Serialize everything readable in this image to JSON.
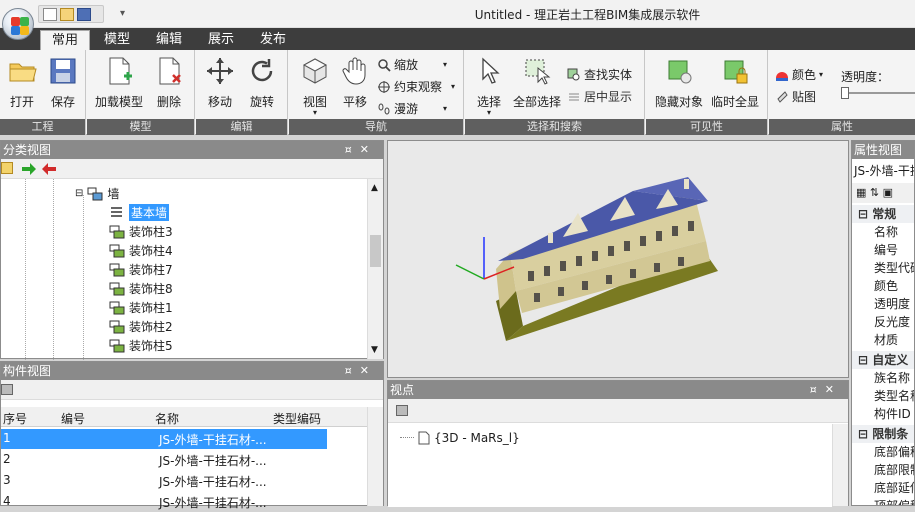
{
  "window": {
    "title": "Untitled - 理正岩土工程BIM集成展示软件"
  },
  "ribbon_tabs": [
    {
      "label": "常用",
      "active": true
    },
    {
      "label": "模型",
      "active": false
    },
    {
      "label": "编辑",
      "active": false
    },
    {
      "label": "展示",
      "active": false
    },
    {
      "label": "发布",
      "active": false
    }
  ],
  "groups": {
    "project": {
      "label": "工程",
      "open": "打开",
      "save": "保存"
    },
    "model": {
      "label": "模型",
      "load": "加载模型",
      "delete": "删除"
    },
    "edit": {
      "label": "编辑",
      "move": "移动",
      "rotate": "旋转"
    },
    "nav": {
      "label": "导航",
      "view": "视图",
      "pan": "平移",
      "zoom": "缩放",
      "constrain": "约束观察",
      "roam": "漫游"
    },
    "select": {
      "label": "选择和搜索",
      "select": "选择",
      "select_all": "全部选择",
      "find": "查找实体",
      "center": "居中显示"
    },
    "visibility": {
      "label": "可见性",
      "hide": "隐藏对象",
      "temp_show": "临时全显"
    },
    "attr": {
      "label": "属性",
      "color": "颜色",
      "texture": "贴图",
      "opacity": "透明度："
    }
  },
  "category_panel": {
    "title": "分类视图",
    "tree": [
      "墙",
      "基本墙",
      "装饰柱3",
      "装饰柱4",
      "装饰柱7",
      "装饰柱8",
      "装饰柱1",
      "装饰柱2",
      "装饰柱5"
    ]
  },
  "component_panel": {
    "title": "构件视图",
    "columns": [
      "序号",
      "编号",
      "名称",
      "类型编码"
    ],
    "rows": [
      {
        "idx": "1",
        "name": "JS-外墙-干挂石材-..."
      },
      {
        "idx": "2",
        "name": "JS-外墙-干挂石材-..."
      },
      {
        "idx": "3",
        "name": "JS-外墙-干挂石材-..."
      },
      {
        "idx": "4",
        "name": "JS-外墙-干挂石材-..."
      }
    ]
  },
  "viewpoint_panel": {
    "title": "视点",
    "item": "{3D - MaRs_l}"
  },
  "property_panel": {
    "title": "属性视图",
    "selected": "JS-外墙-干挂",
    "cat_general": "常规",
    "general": [
      "名称",
      "编号",
      "类型代码",
      "颜色",
      "透明度",
      "反光度",
      "材质"
    ],
    "cat_custom": "自定义",
    "custom": [
      "族名称",
      "类型名称",
      "构件ID"
    ],
    "cat_limit": "限制条",
    "limit": [
      "底部偏移",
      "底部限制",
      "底部延伸",
      "顶部偏移"
    ]
  },
  "colors": {
    "selection": "#3399ff",
    "panel_header": "#8a8a8a",
    "ribbon_tabs": "#3d3d3d"
  }
}
